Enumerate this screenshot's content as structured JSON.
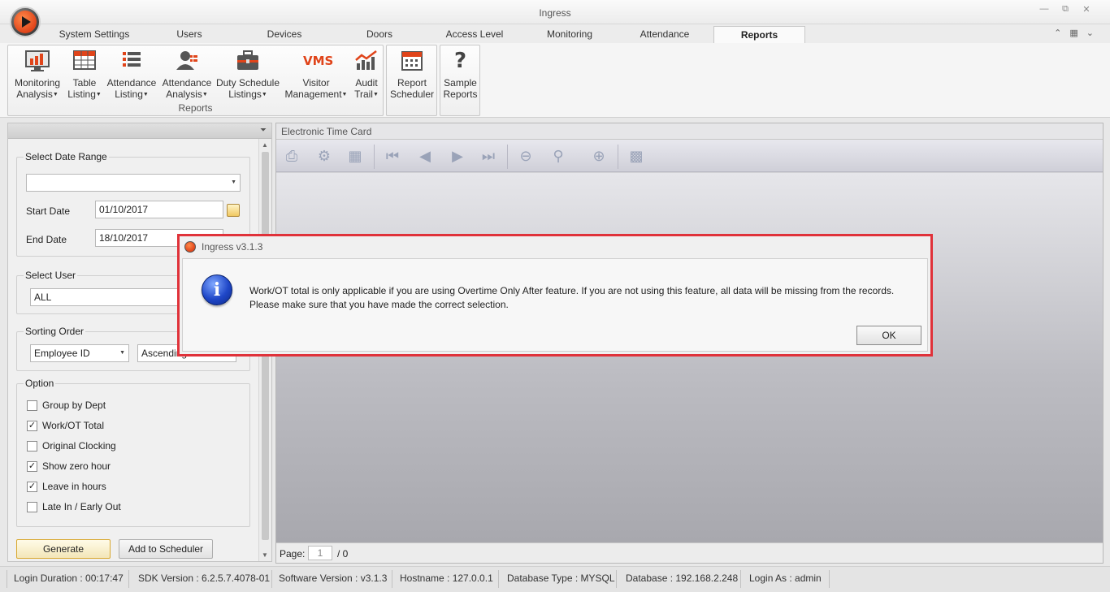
{
  "window": {
    "title": "Ingress"
  },
  "tabs": [
    {
      "label": "System Settings",
      "active": false
    },
    {
      "label": "Users",
      "active": false
    },
    {
      "label": "Devices",
      "active": false
    },
    {
      "label": "Doors",
      "active": false
    },
    {
      "label": "Access Level",
      "active": false
    },
    {
      "label": "Monitoring",
      "active": false
    },
    {
      "label": "Attendance",
      "active": false
    },
    {
      "label": "Reports",
      "active": true
    }
  ],
  "ribbon": {
    "reports_group_label": "Reports",
    "buttons": [
      {
        "line1": "Monitoring",
        "line2": "Analysis",
        "icon": "monitor-chart-icon",
        "dropdown": true
      },
      {
        "line1": "Table",
        "line2": "Listing",
        "icon": "table-icon",
        "dropdown": true
      },
      {
        "line1": "Attendance",
        "line2": "Listing",
        "icon": "list-icon",
        "dropdown": true
      },
      {
        "line1": "Attendance",
        "line2": "Analysis",
        "icon": "person-chart-icon",
        "dropdown": true
      },
      {
        "line1": "Duty Schedule",
        "line2": "Listings",
        "icon": "briefcase-icon",
        "dropdown": true
      },
      {
        "line1": "Visitor",
        "line2": "Management",
        "icon": "vms-icon",
        "icon_text": "VMS",
        "dropdown": true
      },
      {
        "line1": "Audit",
        "line2": "Trail",
        "icon": "trend-chart-icon",
        "dropdown": true
      }
    ],
    "scheduler": {
      "line1": "Report",
      "line2": "Scheduler",
      "icon": "calendar-icon"
    },
    "sample": {
      "line1": "Sample",
      "line2": "Reports",
      "icon": "question-icon",
      "icon_text": "?"
    }
  },
  "left_panel": {
    "date_range": {
      "legend": "Select Date Range",
      "value": ""
    },
    "start_date": {
      "label": "Start Date",
      "value": "01/10/2017"
    },
    "end_date": {
      "label": "End Date",
      "value": "18/10/2017"
    },
    "user": {
      "legend": "Select User",
      "value": "ALL"
    },
    "sorting": {
      "legend": "Sorting Order",
      "field": "Employee ID",
      "direction": "Ascending"
    },
    "options": {
      "legend": "Option",
      "items": [
        {
          "label": "Group by Dept",
          "checked": false
        },
        {
          "label": "Work/OT Total",
          "checked": true
        },
        {
          "label": "Original Clocking",
          "checked": false
        },
        {
          "label": "Show zero hour",
          "checked": true
        },
        {
          "label": "Leave in hours",
          "checked": true
        },
        {
          "label": "Late In / Early Out",
          "checked": false
        }
      ]
    },
    "generate_label": "Generate",
    "add_scheduler_label": "Add to Scheduler"
  },
  "report": {
    "title": "Electronic Time Card",
    "page_label": "Page:",
    "page_value": "1",
    "page_total": "/ 0"
  },
  "status_bar": [
    "Login Duration : 00:17:47",
    "SDK Version : 6.2.5.7.4078-01",
    "Software Version : v3.1.3",
    "Hostname : 127.0.0.1",
    "Database Type : MYSQL",
    "Database : 192.168.2.248",
    "Login As : admin"
  ],
  "dialog": {
    "title": "Ingress v3.1.3",
    "icon": "info-icon",
    "line1": "Work/OT total is only applicable if you are using Overtime Only After feature. If you are not using this feature, all data will be missing from the records.",
    "line2": "Please make sure that you have made the correct selection.",
    "ok_label": "OK"
  },
  "colors": {
    "dialog_highlight": "#e0323a",
    "accent_orange": "#e0441a"
  }
}
